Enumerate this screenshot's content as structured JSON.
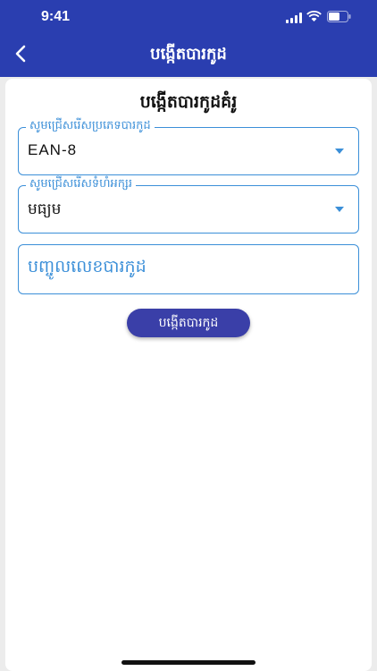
{
  "status_bar": {
    "time": "9:41"
  },
  "nav": {
    "title": "បង្កើតបារកូដ"
  },
  "card": {
    "title": "បង្កើតបារកូដគំរូ",
    "barcode_type": {
      "label": "សូមជ្រើសរើសប្រភេទបារកូដ",
      "value": "EAN-8"
    },
    "font_size": {
      "label": "សូមជ្រើសរើសទំហំអក្សរ",
      "value": "មធ្យម"
    },
    "barcode_input": {
      "placeholder": "បញ្ចូលលេខបារកូដ"
    },
    "generate_button": "បង្កើតបារកូដ"
  },
  "colors": {
    "header": "#2a3eb0",
    "accent": "#3b8fd8",
    "button": "#3a3fa8"
  }
}
